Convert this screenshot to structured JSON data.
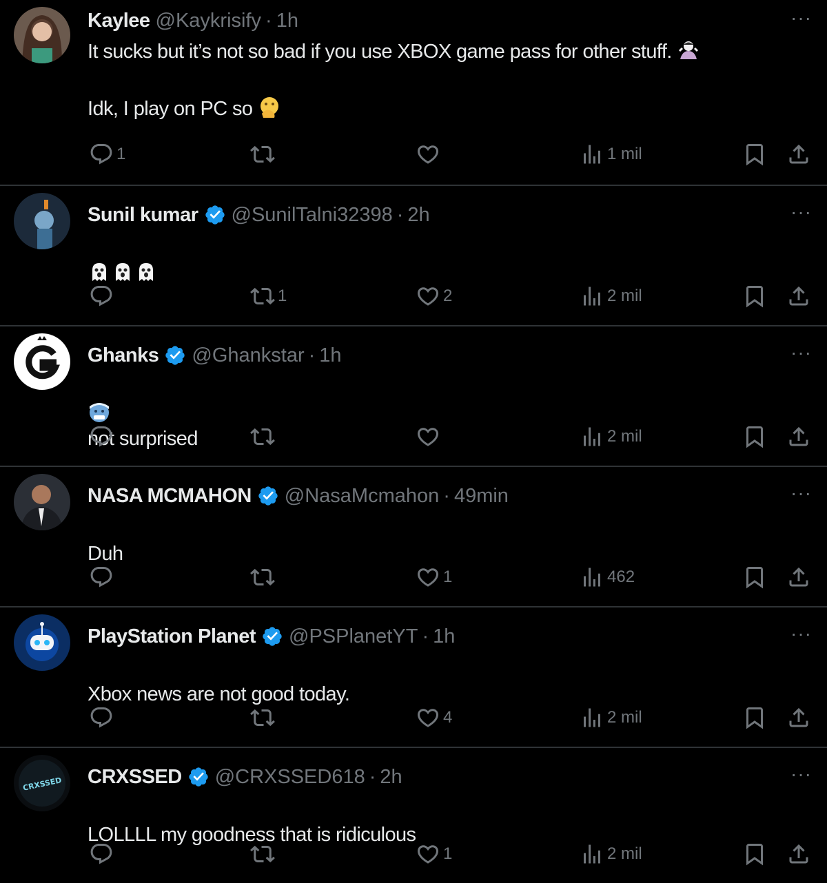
{
  "posts": [
    {
      "name": "Kaylee",
      "verified": false,
      "handle": "@Kaykrisify",
      "time": "1h",
      "text_line1": "It sucks but it’s not so bad if you use XBOX game pass for other stuff.",
      "text_line2": "Idk, I play on PC so",
      "emoji1": "person-shrugging",
      "emoji2": "face-with-hand-over-mouth",
      "replies": "1",
      "reposts": "",
      "likes": "",
      "views": "1 mil"
    },
    {
      "name": "Sunil kumar",
      "verified": true,
      "handle": "@SunilTalni32398",
      "time": "2h",
      "text": "",
      "emoji": "ghost x3",
      "replies": "",
      "reposts": "1",
      "likes": "2",
      "views": "2 mil"
    },
    {
      "name": "Ghanks",
      "verified": true,
      "handle": "@Ghankstar",
      "time": "1h",
      "text": "not surprised",
      "emoji": "cold-face",
      "replies": "",
      "reposts": "",
      "likes": "",
      "views": "2 mil"
    },
    {
      "name": "NASA MCMAHON",
      "verified": true,
      "handle": "@NasaMcmahon",
      "time": "49min",
      "text": "Duh",
      "replies": "",
      "reposts": "",
      "likes": "1",
      "views": "462"
    },
    {
      "name": "PlayStation Planet",
      "verified": true,
      "handle": "@PSPlanetYT",
      "time": "1h",
      "text": "Xbox news are not good today.",
      "replies": "",
      "reposts": "",
      "likes": "4",
      "views": "2 mil"
    },
    {
      "name": "CRXSSED",
      "verified": true,
      "handle": "@CRXSSED618",
      "time": "2h",
      "text": "LOLLLL my goodness that is ridiculous",
      "avatar_text": "CRXSSED",
      "replies": "",
      "reposts": "",
      "likes": "1",
      "views": "2 mil"
    }
  ],
  "colors": {
    "background": "#000000",
    "text": "#e7e9ea",
    "muted": "#71767b",
    "divider": "#2f3336",
    "verified": "#1d9bf0"
  }
}
